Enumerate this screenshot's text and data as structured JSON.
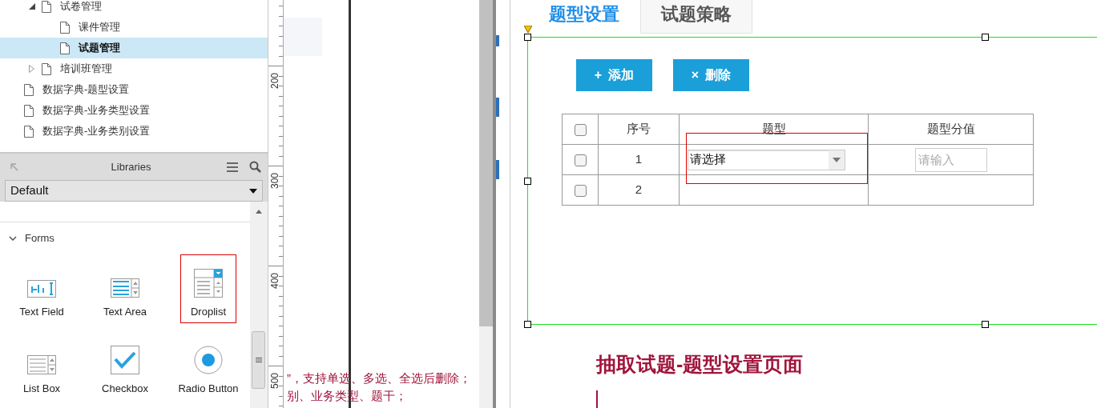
{
  "page_tree": [
    {
      "label": "试卷管理",
      "expanded": true,
      "selected": false,
      "children": [
        {
          "label": "课件管理",
          "selected": false
        },
        {
          "label": "试题管理",
          "selected": true
        }
      ]
    },
    {
      "label": "培训班管理",
      "expanded": false,
      "selected": false
    },
    {
      "label": "数据字典-题型设置",
      "selected": false,
      "root": true
    },
    {
      "label": "数据字典-业务类型设置",
      "selected": false,
      "root": true
    },
    {
      "label": "数据字典-业务类别设置",
      "selected": false,
      "root": true
    }
  ],
  "libraries": {
    "title": "Libraries",
    "library": "Default",
    "section": {
      "label": "Forms",
      "expanded": true
    },
    "widgets": [
      {
        "kind": "textfield",
        "label": "Text Field",
        "selected": false
      },
      {
        "kind": "textarea",
        "label": "Text Area",
        "selected": false
      },
      {
        "kind": "droplist",
        "label": "Droplist",
        "selected": true
      },
      {
        "kind": "listbox",
        "label": "List Box",
        "selected": false
      },
      {
        "kind": "checkbox",
        "label": "Checkbox",
        "selected": false
      },
      {
        "kind": "radio",
        "label": "Radio Button",
        "selected": false
      }
    ]
  },
  "ruler": [
    "200",
    "300",
    "400",
    "500"
  ],
  "notes": [
    "”，支持单选、多选、全选后删除；",
    "别、业务类型、题干；"
  ],
  "tabs": [
    {
      "label": "题型设置",
      "selected": true
    },
    {
      "label": "试题策略",
      "selected": false
    }
  ],
  "buttons": [
    {
      "icon": "+",
      "label": "添加"
    },
    {
      "icon": "×",
      "label": "删除"
    }
  ],
  "table": {
    "header_checked": false,
    "columns": [
      "序号",
      "题型",
      "题型分值"
    ],
    "rows": [
      {
        "checked": false,
        "index": "1",
        "type": "请选择",
        "score_placeholder": "请输入"
      },
      {
        "checked": false,
        "index": "2"
      }
    ]
  },
  "heading": "抽取试题-题型设置页面"
}
